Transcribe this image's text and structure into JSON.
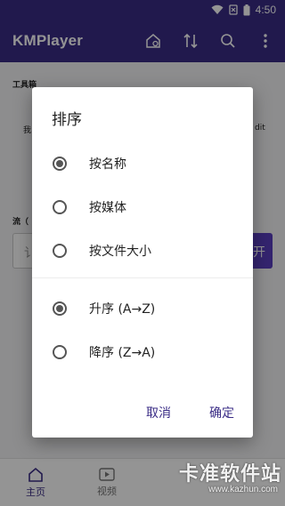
{
  "status_bar": {
    "time": "4:50"
  },
  "app_bar": {
    "title": "KMPlayer"
  },
  "page": {
    "tools_label": "工具箱",
    "tool_hint_left": "我",
    "tool_hint_right": "dit",
    "stream_label": "流（",
    "stream_hint": "讠",
    "stream_button": "开"
  },
  "bottom_nav": {
    "items": [
      {
        "label": "主页"
      },
      {
        "label": "视频"
      }
    ]
  },
  "dialog": {
    "title": "排序",
    "sort_by": [
      {
        "label": "按名称",
        "checked": true
      },
      {
        "label": "按媒体",
        "checked": false
      },
      {
        "label": "按文件大小",
        "checked": false
      }
    ],
    "order": [
      {
        "label": "升序 (A→Z)",
        "checked": true
      },
      {
        "label": "降序 (Z→A)",
        "checked": false
      }
    ],
    "cancel_label": "取消",
    "confirm_label": "确定"
  },
  "watermark": {
    "main": "卡准软件站",
    "url": "www.kazhun.com"
  },
  "colors": {
    "primary": "#3a2c86",
    "accent": "#5a3fc0"
  }
}
